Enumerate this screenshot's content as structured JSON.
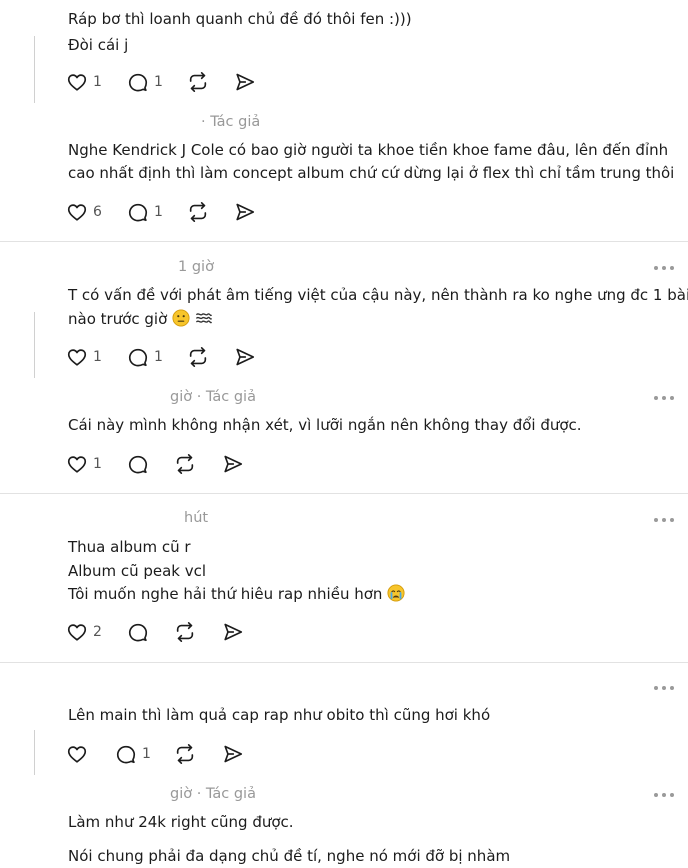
{
  "comments": [
    {
      "lines": [
        "Ráp bơ thì loanh quanh chủ đề đó thôi fen :)))",
        "Đòi cái j"
      ],
      "likes": "1",
      "replies": "1"
    },
    {
      "meta": "· Tác giả",
      "lines": [
        "Nghe Kendrick J Cole có bao giờ người ta khoe tiền khoe fame đâu, lên đến đỉnh",
        "cao nhất định thì làm concept album chứ cứ dừng lại ở flex thì chỉ tầm trung thôi"
      ],
      "likes": "6",
      "replies": "1"
    },
    {
      "meta": "1 giờ",
      "lines": [
        "T có vấn đề với phát âm tiếng việt của cậu này, nên thành ra ko nghe ưng đc 1 bài",
        "nào trước giờ"
      ],
      "likes": "1",
      "replies": "1"
    },
    {
      "meta": "giờ · Tác giả",
      "lines": [
        "Cái này mình không nhận xét, vì lưỡi ngắn nên không thay đổi được."
      ],
      "likes": "1"
    },
    {
      "meta": "hút",
      "lines": [
        "Thua album cũ r",
        "Album cũ peak vcl",
        "Tôi muốn nghe hải thứ hiêu rap nhiều hơn"
      ],
      "likes": "2"
    },
    {
      "lines": [
        "Lên main thì làm quả cap rap như obito thì cũng hơi khó"
      ],
      "replies": "1"
    },
    {
      "meta": "giờ · Tác giả",
      "lines": [
        "Làm như 24k right cũng được.",
        "Nói chung phải đa dạng chủ đề tí, nghe nó mới đỡ bị nhàm"
      ]
    }
  ],
  "icons": {
    "like": "heart-icon",
    "reply": "speech-bubble-icon",
    "repost": "repost-icon",
    "share": "send-icon",
    "more": "ellipsis-icon"
  },
  "colors": {
    "text": "#1c1c1c",
    "meta": "#999999",
    "icon": "#1c1c1c",
    "divider": "#e2e2e2"
  }
}
